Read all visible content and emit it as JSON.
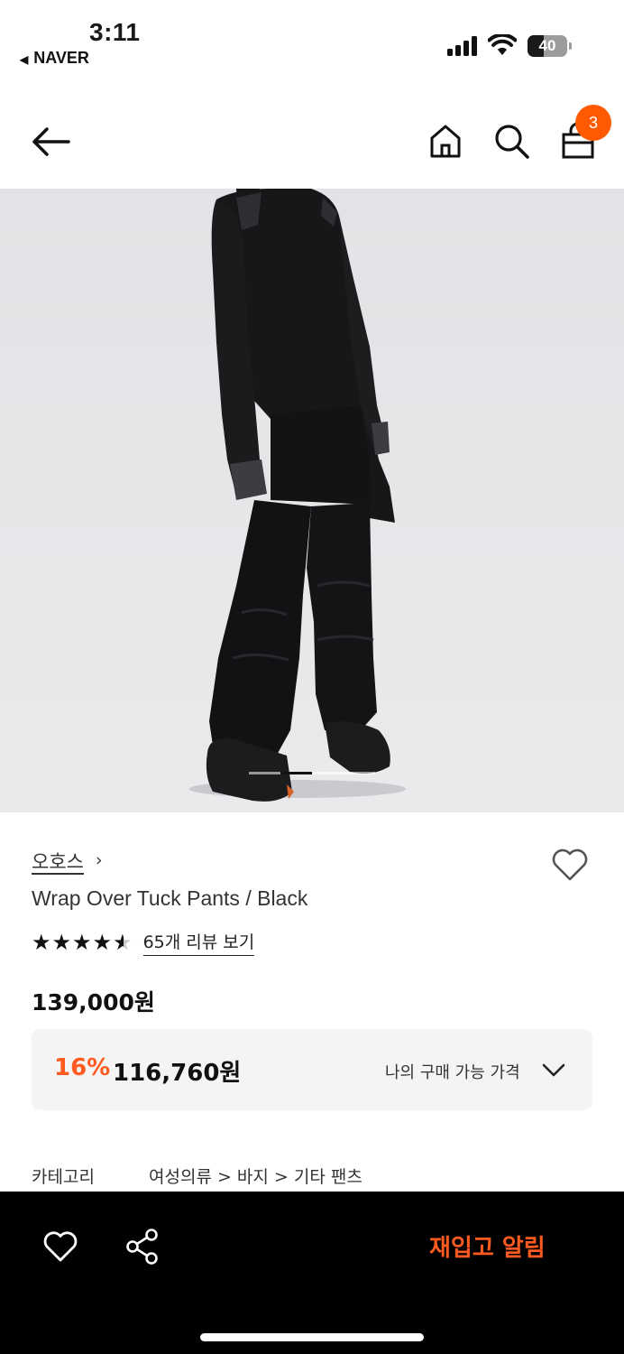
{
  "status_bar": {
    "time": "3:11",
    "back_app_label": "NAVER",
    "battery_level": "40",
    "battery_fraction": 0.4
  },
  "header": {
    "cart_badge_count": "3",
    "icons": [
      "back-arrow-icon",
      "home-icon",
      "search-icon",
      "shopping-bag-icon"
    ]
  },
  "gallery": {
    "image_description_icon": "product-photo",
    "indicator_count": 4,
    "active_index": 1
  },
  "product": {
    "brand": "오호스",
    "brand_chevron": "›",
    "name": "Wrap Over Tuck Pants / Black",
    "rating": 4.5,
    "review_link": "65개 리뷰 보기",
    "original_price": "139,000원",
    "discount_rate": "16%",
    "sale_price": "116,760원",
    "my_price_label": "나의 구매 가능 가격"
  },
  "category": {
    "label": "카테고리",
    "path": "여성의류 > 바지 > 기타 팬츠"
  },
  "bottom_bar": {
    "restock_label": "재입고 알림",
    "icons": [
      "heart-icon",
      "share-icon"
    ]
  },
  "colors": {
    "accent": "#ff5a1f",
    "badge": "#ff5a00",
    "bottom_bar_bg": "#000000",
    "price_box_bg": "#f4f4f4"
  }
}
